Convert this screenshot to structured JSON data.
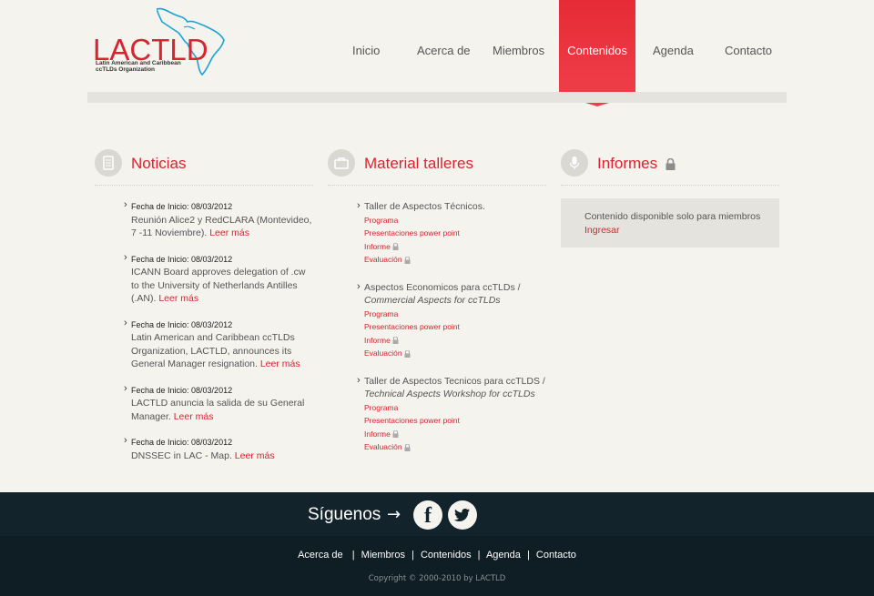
{
  "logo": {
    "brand": "LACTLD",
    "tagline_1": "Latin American and Caribbean",
    "tagline_2": "ccTLDs Organization"
  },
  "nav": {
    "items": [
      "Inicio",
      "Acerca de",
      "Miembros",
      "Contenidos",
      "Agenda",
      "Contacto"
    ],
    "active": "Contenidos"
  },
  "colors": {
    "accent": "#d9232e",
    "footer": "#12232c"
  },
  "noticias": {
    "title": "Noticias",
    "items": [
      {
        "date": "Fecha de Inicio: 08/03/2012",
        "text": "Reunión Alice2 y RedCLARA (Montevideo, 7 -11 Noviembre).",
        "link": "Leer más"
      },
      {
        "date": "Fecha de Inicio: 08/03/2012",
        "text": "ICANN Board approves delegation of .cw to the University of Netherlands Antilles (.AN).",
        "link": "Leer más"
      },
      {
        "date": "Fecha de Inicio: 08/03/2012",
        "text": "Latin American and Caribbean ccTLDs Organization, LACTLD, announces its General Manager resignation.",
        "link": "Leer más"
      },
      {
        "date": "Fecha de Inicio: 08/03/2012",
        "text": "LACTLD anuncia la salida de su General Manager.",
        "link": "Leer más"
      },
      {
        "date": "Fecha de Inicio: 08/03/2012",
        "text": "DNSSEC in LAC - Map.",
        "link": "Leer más"
      }
    ]
  },
  "material": {
    "title": "Material talleres",
    "items": [
      {
        "title": "Taller de Aspectos Técnicos.",
        "subtitle": "",
        "links": [
          "Programa",
          "Presentaciones power point",
          "Informe",
          "Evaluación"
        ]
      },
      {
        "title": "Aspectos Economicos para ccTLDs /",
        "subtitle": "Commercial Aspects for ccTLDs",
        "links": [
          "Programa",
          "Presentaciones power point",
          "Informe",
          "Evaluación"
        ]
      },
      {
        "title": "Taller de Aspectos Tecnicos para ccTLDS /",
        "subtitle": "Technical Aspects Workshop for ccTLDs",
        "links": [
          "Programa",
          "Presentaciones power point",
          "Informe",
          "Evaluación"
        ]
      }
    ]
  },
  "informes": {
    "title": "Informes",
    "message": "Contenido disponible solo para miembros",
    "login_link": "Ingresar"
  },
  "social": {
    "label": "Síguenos",
    "arrow": "→",
    "facebook_glyph": "f"
  },
  "footer": {
    "links": [
      "Acerca de",
      "Miembros",
      "Contenidos",
      "Agenda",
      "Contacto"
    ],
    "copyright": "Copyright © 2000-2010 by LACTLD"
  }
}
